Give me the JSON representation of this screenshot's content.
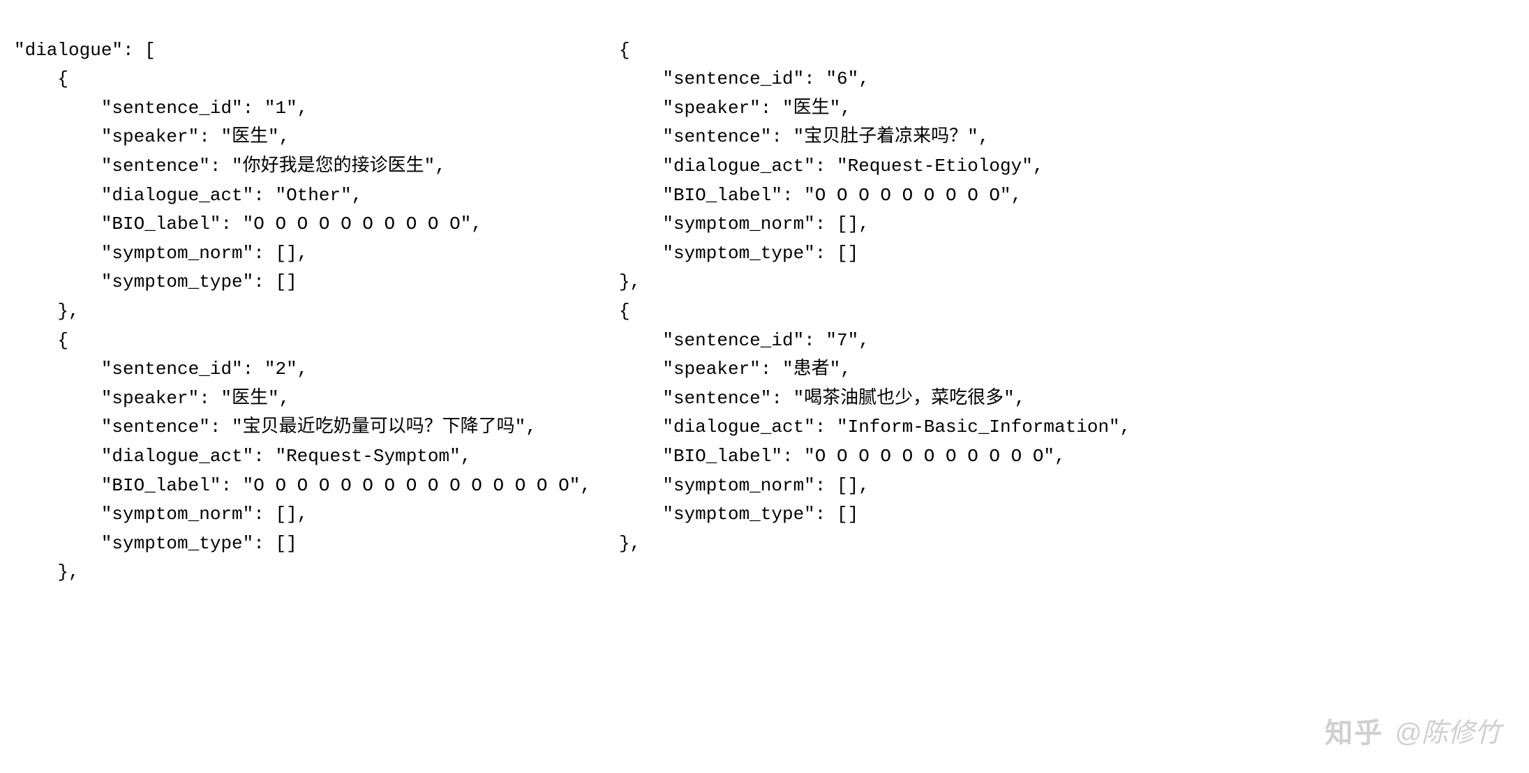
{
  "left": {
    "header": "\"dialogue\": [",
    "open1": "    {",
    "s1_id": "        \"sentence_id\": \"1\",",
    "s1_speaker": "        \"speaker\": \"医生\",",
    "s1_sent": "        \"sentence\": \"你好我是您的接诊医生\",",
    "s1_act": "        \"dialogue_act\": \"Other\",",
    "s1_bio": "        \"BIO_label\": \"O O O O O O O O O O\",",
    "s1_norm": "        \"symptom_norm\": [],",
    "s1_type": "        \"symptom_type\": []",
    "close1": "    },",
    "open2": "    {",
    "s2_id": "        \"sentence_id\": \"2\",",
    "s2_speaker": "        \"speaker\": \"医生\",",
    "s2_sent": "        \"sentence\": \"宝贝最近吃奶量可以吗？下降了吗\",",
    "s2_act": "        \"dialogue_act\": \"Request-Symptom\",",
    "s2_bio": "        \"BIO_label\": \"O O O O O O O O O O O O O O O\",",
    "s2_norm": "        \"symptom_norm\": [],",
    "s2_type": "        \"symptom_type\": []",
    "close2": "    },"
  },
  "right": {
    "open6": "{",
    "s6_id": "    \"sentence_id\": \"6\",",
    "s6_speaker": "    \"speaker\": \"医生\",",
    "s6_sent": "    \"sentence\": \"宝贝肚子着凉来吗？\",",
    "s6_act": "    \"dialogue_act\": \"Request-Etiology\",",
    "s6_bio": "    \"BIO_label\": \"O O O O O O O O O\",",
    "s6_norm": "    \"symptom_norm\": [],",
    "s6_type": "    \"symptom_type\": []",
    "close6": "},",
    "open7": "{",
    "s7_id": "    \"sentence_id\": \"7\",",
    "s7_speaker": "    \"speaker\": \"患者\",",
    "s7_sent": "    \"sentence\": \"喝茶油腻也少，菜吃很多\",",
    "s7_act": "    \"dialogue_act\": \"Inform-Basic_Information\",",
    "s7_bio": "    \"BIO_label\": \"O O O O O O O O O O O\",",
    "s7_norm": "    \"symptom_norm\": [],",
    "s7_type": "    \"symptom_type\": []",
    "close7": "},"
  },
  "watermark": {
    "brand": "知乎",
    "author": "@陈修竹"
  }
}
